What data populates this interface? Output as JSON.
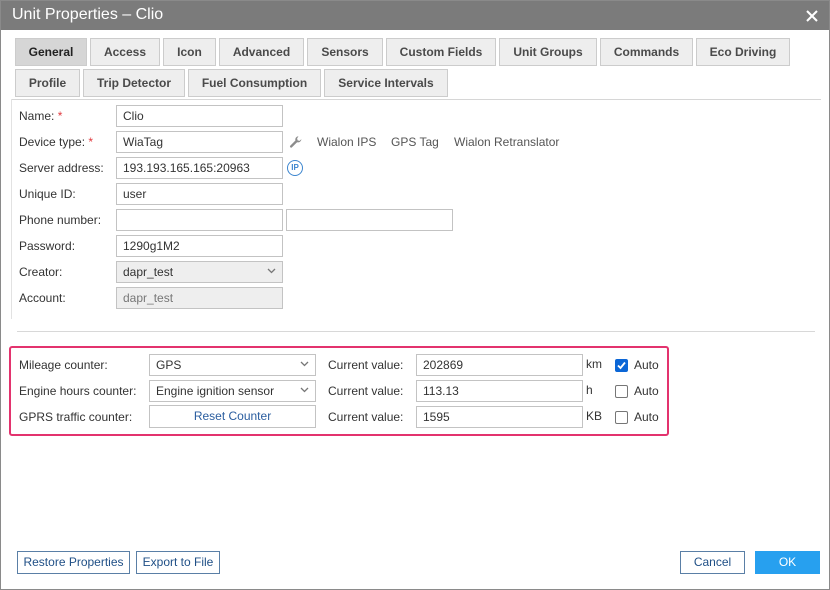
{
  "window": {
    "title": "Unit Properties – Clio"
  },
  "tabs": [
    {
      "label": "General"
    },
    {
      "label": "Access"
    },
    {
      "label": "Icon"
    },
    {
      "label": "Advanced"
    },
    {
      "label": "Sensors"
    },
    {
      "label": "Custom Fields"
    },
    {
      "label": "Unit Groups"
    },
    {
      "label": "Commands"
    },
    {
      "label": "Eco Driving"
    },
    {
      "label": "Profile"
    },
    {
      "label": "Trip Detector"
    },
    {
      "label": "Fuel Consumption"
    },
    {
      "label": "Service Intervals"
    }
  ],
  "active_tab": "General",
  "form": {
    "name_label": "Name:",
    "name_value": "Clio",
    "device_type_label": "Device type:",
    "device_type_value": "WiaTag",
    "required_mark": "*",
    "device_links": [
      "Wialon IPS",
      "GPS Tag",
      "Wialon Retranslator"
    ],
    "server_address_label": "Server address:",
    "server_address_value": "193.193.165.165:20963",
    "ip_icon_text": "IP",
    "unique_id_label": "Unique ID:",
    "unique_id_value": "user",
    "phone_label": "Phone number:",
    "phone_value_1": "",
    "phone_value_2": "",
    "password_label": "Password:",
    "password_value": "1290g1M2",
    "creator_label": "Creator:",
    "creator_value": "dapr_test",
    "account_label": "Account:",
    "account_value": "dapr_test"
  },
  "counters": {
    "current_value_label": "Current value:",
    "auto_label": "Auto",
    "mileage": {
      "label": "Mileage counter:",
      "select": "GPS",
      "value": "202869",
      "unit": "km",
      "auto": true
    },
    "engine": {
      "label": "Engine hours counter:",
      "select": "Engine ignition sensor",
      "value": "113.13",
      "unit": "h",
      "auto": false
    },
    "gprs": {
      "label": "GPRS traffic counter:",
      "button": "Reset Counter",
      "value": "1595",
      "unit": "KB",
      "auto": false
    }
  },
  "footer": {
    "restore": "Restore Properties",
    "export": "Export to File",
    "cancel": "Cancel",
    "ok": "OK"
  },
  "colors": {
    "titlebar": "#7b7b7b",
    "highlight_border": "#e3336e",
    "primary_button": "#27a0ef",
    "link_blue": "#3d86cf",
    "required": "#e0393e"
  },
  "icons": {
    "close": "close-icon",
    "wrench": "wrench-icon",
    "ip": "ip-icon",
    "chevron": "chevron-down-icon",
    "check": "check-icon"
  }
}
